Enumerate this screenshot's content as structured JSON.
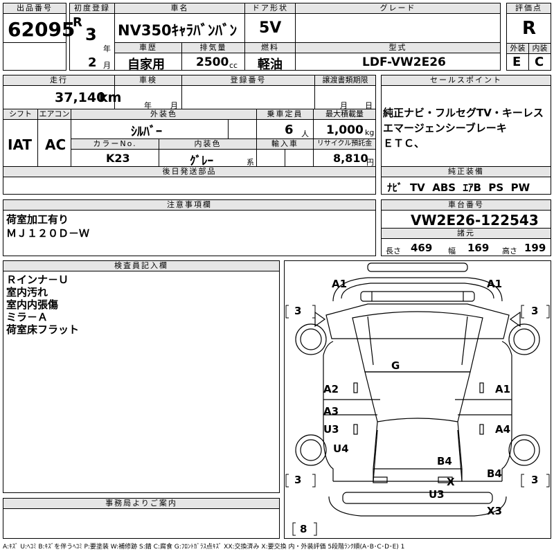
{
  "headers": {
    "lot_no": "出品番号",
    "first_reg": "初度登録",
    "car_name": "車名",
    "door": "ドア形状",
    "grade": "グレード",
    "score": "評価点",
    "history": "車歴",
    "displacement": "排気量",
    "fuel": "燃料",
    "model": "型式",
    "exterior": "外装",
    "interior": "内装",
    "mileage": "走行",
    "inspection": "車検",
    "registration": "登録番号",
    "transfer": "譲渡書類期限",
    "sales_point": "セールスポイント",
    "shift": "シフト",
    "aircon": "エアコン",
    "ext_color": "外装色",
    "capacity": "乗車定員",
    "max_load": "最大積載量",
    "color_no": "カラーNo.",
    "int_color": "内装色",
    "import": "輸入車",
    "recycle": "リサイクル預託金",
    "later_parts": "後日発送部品",
    "genuine": "純正装備",
    "notes": "注意事項欄",
    "chassis": "車台番号",
    "dimensions": "諸元",
    "inspector": "検査員記入欄",
    "office": "事務局よりご案内"
  },
  "values": {
    "lot_no": "62095",
    "era": "R",
    "year": "3",
    "year_unit": "年",
    "month": "2",
    "month_unit": "月",
    "car_name": "NV350ｷｬﾗﾊﾞﾝﾊﾞﾝ",
    "door": "5V",
    "grade": "",
    "score": "R",
    "history": "自家用",
    "displacement": "2500",
    "displacement_unit": "cc",
    "fuel": "軽油",
    "model": "LDF-VW2E26",
    "exterior": "E",
    "interior": "C",
    "mileage": "37,140",
    "mileage_unit": "km",
    "insp_year_unit": "年",
    "insp_month_unit": "月",
    "transfer_month_unit": "月",
    "transfer_day_unit": "日",
    "shift": "IAT",
    "aircon": "AC",
    "ext_color": "ｼﾙﾊﾞｰ",
    "capacity": "6",
    "capacity_unit": "人",
    "max_load": "1,000",
    "max_load_unit": "kg",
    "color_no": "K23",
    "int_color": "ｸﾞﾚｰ",
    "int_color_unit": "系",
    "recycle": "8,810",
    "recycle_unit": "円",
    "sales_points": [
      "純正ナビ・フルセグTV・キーレス",
      "エマージェンシーブレーキ",
      "ＥＴＣ、"
    ],
    "genuine": "ﾅﾋﾞ  TV  ABS  ｴｱB  PS  PW",
    "notes": [
      "荷室加工有り",
      "ＭＪ１２０Ｄ－Ｗ"
    ],
    "chassis": "VW2E26-122543",
    "length_label": "長さ",
    "length": "469",
    "width_label": "幅",
    "width": "169",
    "height_label": "高さ",
    "height": "199",
    "inspector_notes": [
      "Ｒインナ－Ｕ",
      "室内汚れ",
      "室内内張傷",
      "ミラ－Ａ",
      "荷室床フラット"
    ],
    "legend": "A:ｷｽﾞ U:ﾍｺﾐ B:ｷｽﾞを伴うﾍｺﾐ P:要塗装 W:補修跡 S:錆 C:腐食 G:ﾌﾛﾝﾄｶﾞﾗｽ点ｷｽﾞ XX:交換済み X:要交換 内・外装評価 5段階ﾗﾝｸ順(A･B･C･D･E) 1"
  },
  "diagram": {
    "front_left": "A1",
    "front_right": "A1",
    "tire_fl": "3",
    "tire_fr": "3",
    "windshield": "G",
    "left_front_door": "A2",
    "right_front_door": "A1",
    "left_rear_upper": "A3",
    "left_rear_lower": "U3",
    "right_rear": "A4",
    "left_quarter": "U4",
    "rear_right": "B4",
    "right_quarter": "B4",
    "tire_rl": "3",
    "tire_rr": "3",
    "rear_bumper_x": "X",
    "rear_u": "U3",
    "rear_x3": "X3",
    "spare": "8"
  }
}
